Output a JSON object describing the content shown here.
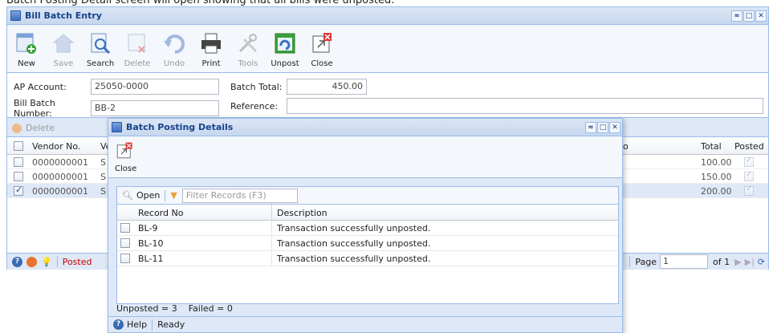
{
  "caption": "Batch Posting Detail screen will open showing that all bills were unposted.",
  "main_window": {
    "title": "Bill Batch Entry",
    "toolbar": [
      {
        "label": "New",
        "icon": "new-icon",
        "disabled": false
      },
      {
        "label": "Save",
        "icon": "save-icon",
        "disabled": true
      },
      {
        "label": "Search",
        "icon": "search-icon",
        "disabled": false
      },
      {
        "label": "Delete",
        "icon": "delete-icon",
        "disabled": true
      },
      {
        "label": "Undo",
        "icon": "undo-icon",
        "disabled": true
      },
      {
        "label": "Print",
        "icon": "print-icon",
        "disabled": false
      },
      {
        "label": "Tools",
        "icon": "tools-icon",
        "disabled": true
      },
      {
        "label": "Unpost",
        "icon": "unpost-icon",
        "disabled": false
      },
      {
        "label": "Close",
        "icon": "close-icon",
        "disabled": false
      }
    ],
    "form": {
      "ap_account_label": "AP Account:",
      "ap_account_value": "25050-0000",
      "batch_total_label": "Batch Total:",
      "batch_total_value": "450.00",
      "bill_batch_number_label": "Bill Batch Number:",
      "bill_batch_number_value": "BB-2",
      "reference_label": "Reference:",
      "reference_value": ""
    },
    "grid": {
      "delete_label": "Delete",
      "columns": {
        "vendor_no": "Vendor No.",
        "vendor_name": "Ve",
        "partial": "o",
        "total": "Total",
        "posted": "Posted"
      },
      "rows": [
        {
          "vendor_no": "0000000001",
          "vendor_name": "S",
          "total": "100.00",
          "checked": false
        },
        {
          "vendor_no": "0000000001",
          "vendor_name": "S",
          "total": "150.00",
          "checked": false
        },
        {
          "vendor_no": "0000000001",
          "vendor_name": "S",
          "total": "200.00",
          "checked": true
        }
      ]
    },
    "status": {
      "status_text": "Posted",
      "page_label": "Page",
      "page_value": "1",
      "page_of": "of 1"
    }
  },
  "popup": {
    "title": "Batch Posting Details",
    "close_label": "Close",
    "open_label": "Open",
    "filter_placeholder": "Filter Records (F3)",
    "columns": {
      "record_no": "Record No",
      "description": "Description"
    },
    "rows": [
      {
        "record_no": "BL-9",
        "description": "Transaction successfully unposted."
      },
      {
        "record_no": "BL-10",
        "description": "Transaction successfully unposted."
      },
      {
        "record_no": "BL-11",
        "description": "Transaction successfully unposted."
      }
    ],
    "summary": "Unposted = 3    Failed = 0",
    "help_label": "Help",
    "ready_label": "Ready"
  },
  "colors": {
    "accent": "#15428b",
    "border": "#99bbe8",
    "panel": "#dfe8f6",
    "posted": "#cc0000"
  }
}
